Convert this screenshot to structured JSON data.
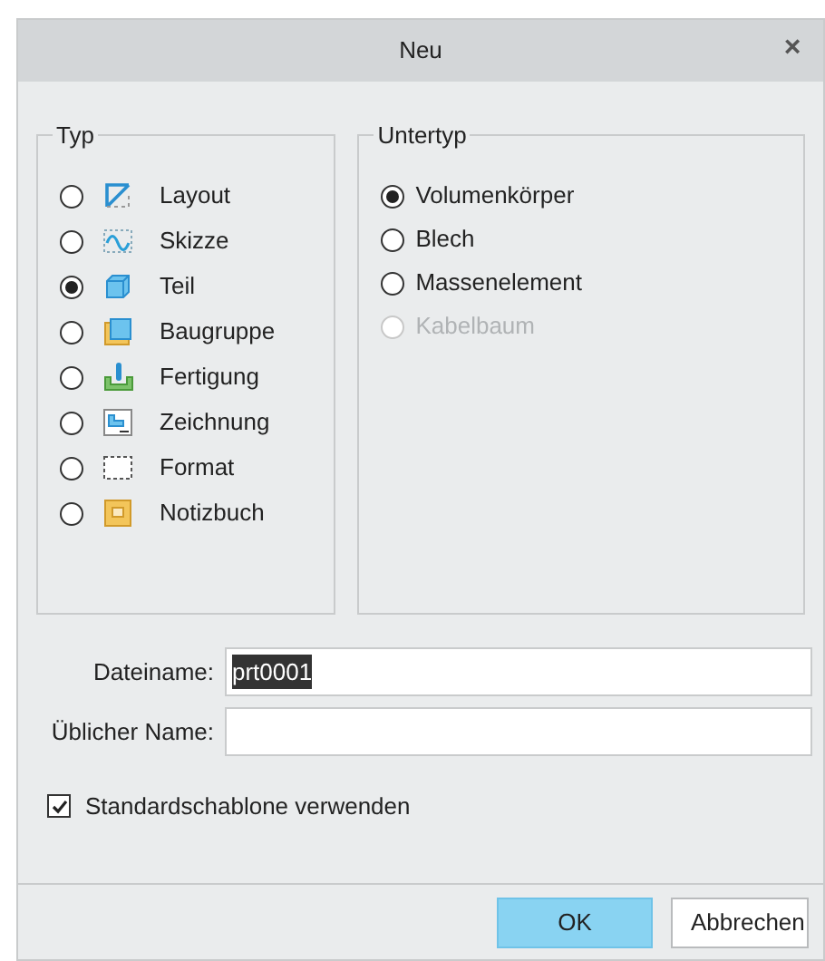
{
  "window": {
    "title": "Neu",
    "close": "×"
  },
  "type_group": {
    "title": "Typ",
    "items": [
      {
        "label": "Layout",
        "kind": "layout",
        "selected": false
      },
      {
        "label": "Skizze",
        "kind": "sketch",
        "selected": false
      },
      {
        "label": "Teil",
        "kind": "part",
        "selected": true
      },
      {
        "label": "Baugruppe",
        "kind": "assembly",
        "selected": false
      },
      {
        "label": "Fertigung",
        "kind": "manufacturing",
        "selected": false
      },
      {
        "label": "Zeichnung",
        "kind": "drawing",
        "selected": false
      },
      {
        "label": "Format",
        "kind": "format",
        "selected": false
      },
      {
        "label": "Notizbuch",
        "kind": "notebook",
        "selected": false
      }
    ]
  },
  "subtype_group": {
    "title": "Untertyp",
    "items": [
      {
        "label": "Volumenkörper",
        "selected": true,
        "disabled": false
      },
      {
        "label": "Blech",
        "selected": false,
        "disabled": false
      },
      {
        "label": "Massenelement",
        "selected": false,
        "disabled": false
      },
      {
        "label": "Kabelbaum",
        "selected": false,
        "disabled": true
      }
    ]
  },
  "fields": [
    {
      "label": "Dateiname:",
      "value": "prt0001",
      "text_selected": true
    },
    {
      "label": "Üblicher Name:"
    }
  ],
  "use_default_template": {
    "label": "Standardschablone verwenden",
    "checked": true
  },
  "buttons": [
    {
      "label": "OK",
      "primary": true
    },
    {
      "label": "Abbrechen",
      "primary": false
    }
  ]
}
